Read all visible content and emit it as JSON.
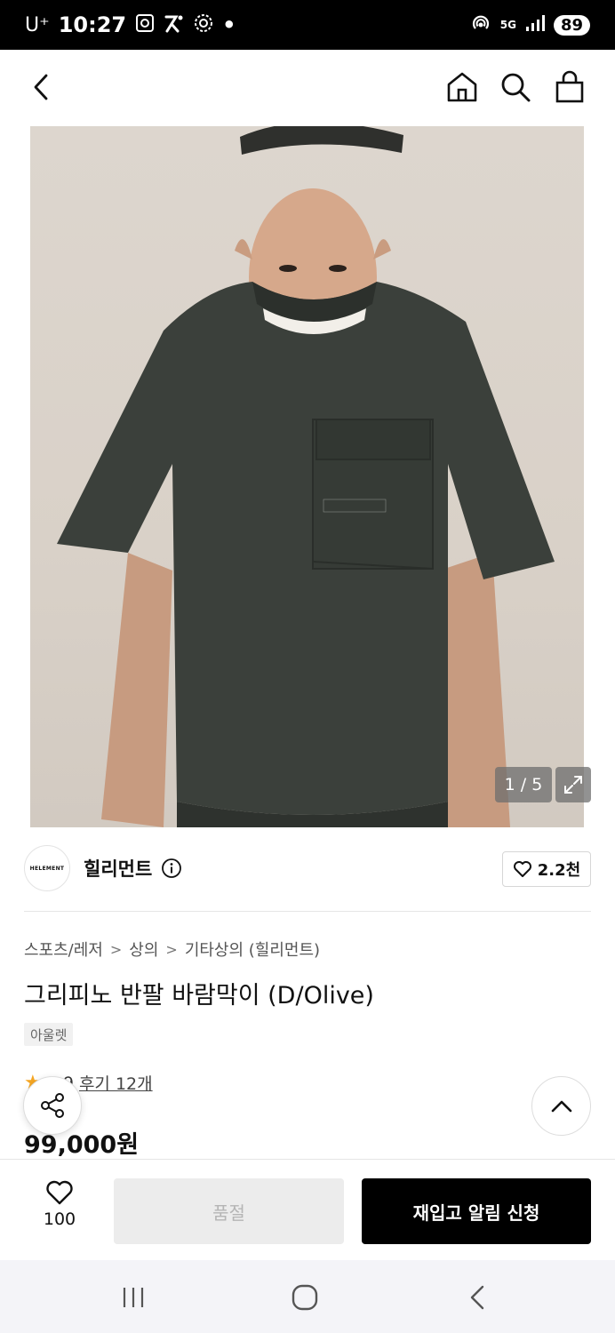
{
  "status_bar": {
    "carrier": "U⁺",
    "time": "10:27",
    "network": "5G",
    "battery": "89",
    "dot": "•",
    "left_icons": [
      "screenshot-icon",
      "runner-app-icon",
      "settings-flower-icon"
    ],
    "right_icons": [
      "hotspot-icon",
      "signal-icon"
    ]
  },
  "nav": {
    "icons": [
      "back-arrow-icon",
      "home-icon",
      "search-icon",
      "shopping-bag-icon"
    ]
  },
  "gallery": {
    "counter": "1 / 5",
    "expand_icon": "expand-icon"
  },
  "brand": {
    "logo_text": "HELEMENT",
    "name": "힐리먼트",
    "info_icon": "info-icon",
    "likes": "2.2천",
    "heart_icon": "heart-icon"
  },
  "breadcrumb": [
    "스포츠/레저",
    "상의",
    "기타상의 (힐리먼트)"
  ],
  "breadcrumb_separator": ">",
  "product": {
    "title": "그리피노 반팔 바람막이 (D/Olive)",
    "tag": "아울렛",
    "rating_star": "★",
    "rating": "4.9",
    "reviews": "후기 12개",
    "price": "99,000원"
  },
  "bottom_bar": {
    "wish_count": "100",
    "soldout_label": "품절",
    "restock_label": "재입고 알림 신청"
  },
  "system_nav": [
    "recent-apps-icon",
    "home-circle-icon",
    "system-back-icon"
  ],
  "colors": {
    "status_bar": "#000000",
    "accent_button": "#000000",
    "disabled_button": "#ececec",
    "shirt": "#3b403b",
    "star": "#f5a623"
  }
}
